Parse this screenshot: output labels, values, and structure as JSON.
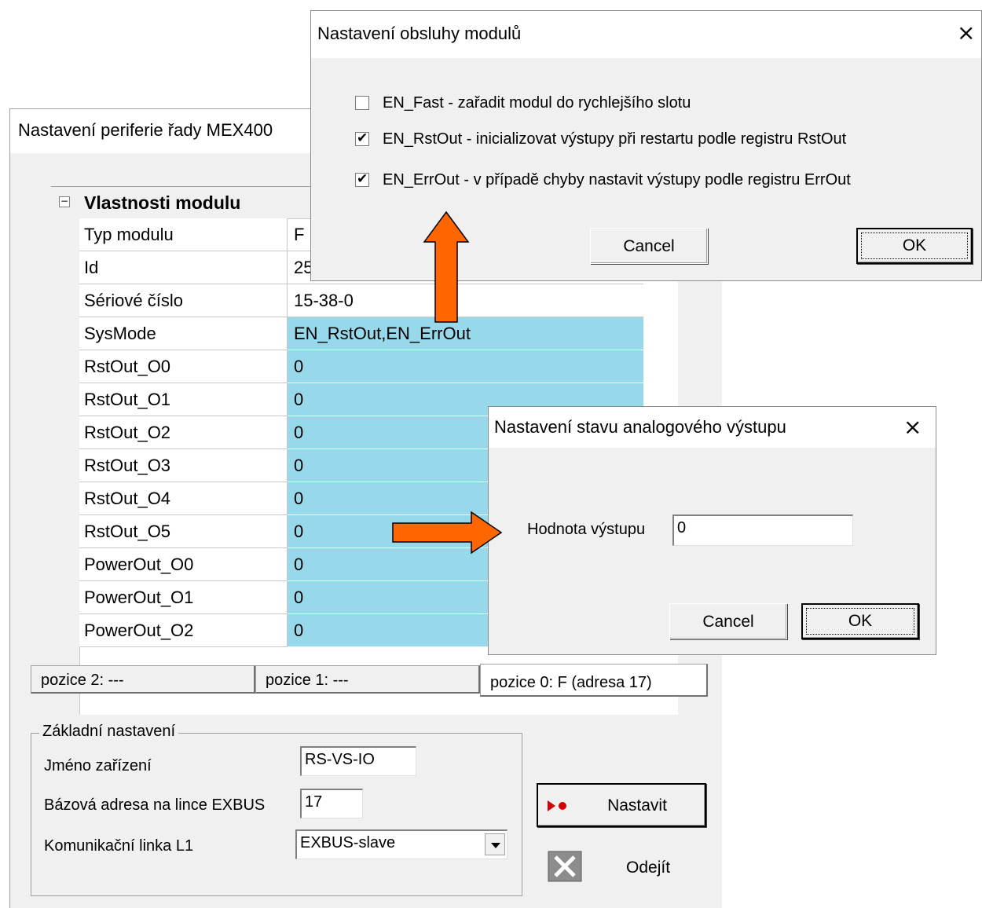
{
  "main_window": {
    "title": "Nastavení periferie řady MEX400",
    "grid": {
      "group_label": "Vlastnosti modulu",
      "rows": [
        {
          "name": "Typ modulu",
          "value": "F",
          "highlight": false
        },
        {
          "name": "Id",
          "value": "25",
          "highlight": false
        },
        {
          "name": "Sériové číslo",
          "value": "15-38-0",
          "highlight": false
        },
        {
          "name": "SysMode",
          "value": "EN_RstOut,EN_ErrOut",
          "highlight": true
        },
        {
          "name": "RstOut_O0",
          "value": "0",
          "highlight": true
        },
        {
          "name": "RstOut_O1",
          "value": "0",
          "highlight": true
        },
        {
          "name": "RstOut_O2",
          "value": "0",
          "highlight": true
        },
        {
          "name": "RstOut_O3",
          "value": "0",
          "highlight": true
        },
        {
          "name": "RstOut_O4",
          "value": "0",
          "highlight": true
        },
        {
          "name": "RstOut_O5",
          "value": "0",
          "highlight": true
        },
        {
          "name": "PowerOut_O0",
          "value": "0",
          "highlight": true
        },
        {
          "name": "PowerOut_O1",
          "value": "0",
          "highlight": true
        },
        {
          "name": "PowerOut_O2",
          "value": "0",
          "highlight": true
        }
      ]
    },
    "tabs": [
      {
        "label": "pozice 2: ---"
      },
      {
        "label": "pozice 1: ---"
      },
      {
        "label": "pozice 0: F (adresa 17)",
        "active": true
      }
    ],
    "basic": {
      "legend": "Základní nastavení",
      "device_name_label": "Jméno zařízení",
      "device_name_value": "RS-VS-IO",
      "base_address_label": "Bázová adresa na lince EXBUS",
      "base_address_value": "17",
      "comm_line_label": "Komunikační linka L1",
      "comm_line_value": "EXBUS-slave"
    },
    "set_button": "Nastavit",
    "exit_button": "Odejít"
  },
  "dialog_sysmode": {
    "title": "Nastavení obsluhy modulů",
    "options": [
      {
        "label": "EN_Fast - zařadit modul do rychlejšího slotu",
        "checked": false
      },
      {
        "label": "EN_RstOut - inicializovat výstupy při restartu podle registru RstOut",
        "checked": true
      },
      {
        "label": "EN_ErrOut - v případě chyby nastavit výstupy podle registru ErrOut",
        "checked": true
      }
    ],
    "cancel": "Cancel",
    "ok": "OK",
    "close_icon": "×"
  },
  "dialog_analog": {
    "title": "Nastavení stavu analogového výstupu",
    "value_label": "Hodnota výstupu",
    "value": "0",
    "cancel": "Cancel",
    "ok": "OK",
    "close_icon": "×"
  },
  "colors": {
    "highlight": "#97d8ea",
    "arrow": "#ff6600"
  }
}
